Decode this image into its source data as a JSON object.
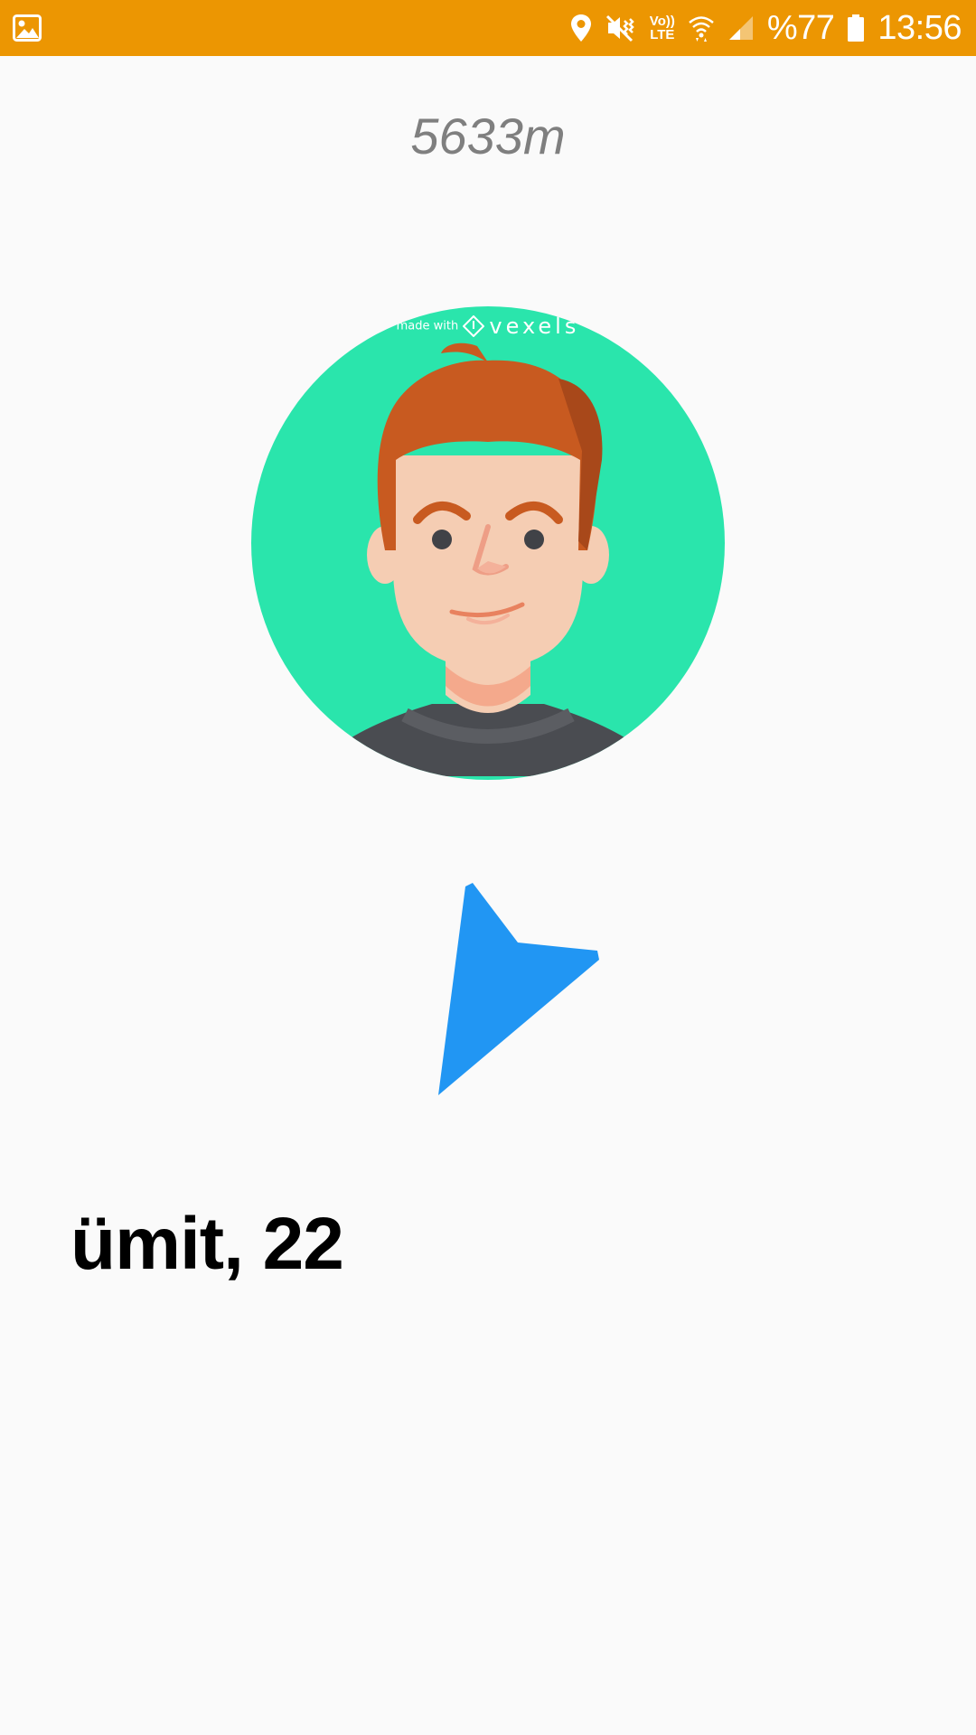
{
  "status_bar": {
    "background_color": "#ec9602",
    "left_icon": "image-icon",
    "icons": [
      "location-pin-icon",
      "mute-vibrate-icon",
      "volte-icon",
      "wifi-icon",
      "cell-signal-icon",
      "battery-icon"
    ],
    "volte_label_top": "Vo))",
    "volte_label_bottom": "LTE",
    "battery_text": "%77",
    "time": "13:56"
  },
  "profile": {
    "distance": "5633m",
    "avatar_watermark_small": "made with",
    "avatar_watermark_brand": "vexels",
    "avatar_background_color": "#2ae5ac",
    "direction_icon": "navigation-arrow-icon",
    "direction_color": "#2196f3",
    "name_age": "ümit, 22"
  }
}
